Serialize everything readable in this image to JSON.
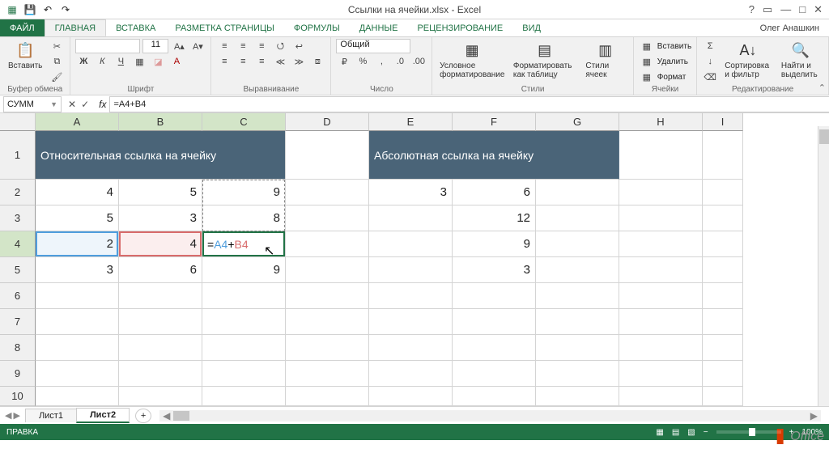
{
  "title": "Ссылки на ячейки.xlsx - Excel",
  "user": "Олег Анашкин",
  "tabs": {
    "file": "ФАЙЛ",
    "home": "ГЛАВНАЯ",
    "insert": "ВСТАВКА",
    "layout": "РАЗМЕТКА СТРАНИЦЫ",
    "formulas": "ФОРМУЛЫ",
    "data": "ДАННЫЕ",
    "review": "РЕЦЕНЗИРОВАНИЕ",
    "view": "ВИД"
  },
  "ribbon": {
    "paste": "Вставить",
    "clipboard": "Буфер обмена",
    "font_size": "11",
    "font_group": "Шрифт",
    "align_group": "Выравнивание",
    "number_format": "Общий",
    "number_group": "Число",
    "cond_fmt": "Условное форматирование",
    "fmt_table": "Форматировать как таблицу",
    "cell_styles": "Стили ячеек",
    "styles_group": "Стили",
    "ins": "Вставить",
    "del": "Удалить",
    "fmt": "Формат",
    "cells_group": "Ячейки",
    "sort": "Сортировка и фильтр",
    "find": "Найти и выделить",
    "edit_group": "Редактирование"
  },
  "namebox": "СУММ",
  "formula": "=A4+B4",
  "columns": [
    "A",
    "B",
    "C",
    "D",
    "E",
    "F",
    "G",
    "H",
    "I"
  ],
  "headers": {
    "rel": "Относительная ссылка на ячейку",
    "abs": "Абсолютная ссылка на ячейку"
  },
  "data": {
    "a2": "4",
    "b2": "5",
    "c2": "9",
    "e2": "3",
    "f2": "6",
    "a3": "5",
    "b3": "3",
    "c3": "8",
    "f3": "12",
    "a4": "2",
    "b4": "4",
    "f4": "9",
    "a5": "3",
    "b5": "6",
    "c5": "9",
    "f5": "3"
  },
  "edit": {
    "eq": "=",
    "ra": "A4",
    "op": "+",
    "rb": "B4"
  },
  "sheets": {
    "s1": "Лист1",
    "s2": "Лист2"
  },
  "status": "ПРАВКА",
  "zoom": "100%",
  "officelabel": "Office"
}
